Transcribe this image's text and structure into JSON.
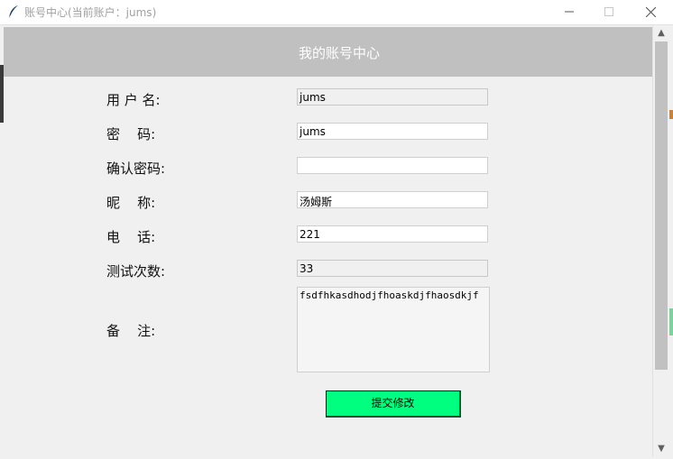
{
  "window": {
    "title": "账号中心(当前账户：jums)",
    "controls": {
      "minimize": "minimize",
      "maximize": "maximize",
      "close": "close"
    }
  },
  "header": {
    "title": "我的账号中心"
  },
  "form": {
    "username": {
      "label": "用 户 名:",
      "value": "jums",
      "readonly": true
    },
    "password": {
      "label": "密    码:",
      "value": "jums"
    },
    "confirm_password": {
      "label": "确认密码:",
      "value": ""
    },
    "nickname": {
      "label": "昵    称:",
      "value": "汤姆斯"
    },
    "phone": {
      "label": "电    话:",
      "value": "221"
    },
    "test_count": {
      "label": "测试次数:",
      "value": "33",
      "readonly": true
    },
    "notes": {
      "label": "备    注:",
      "value": "fsdfhkasdhodjfhoaskdjfhaosdkjf"
    }
  },
  "submit": {
    "label": "提交修改"
  },
  "colors": {
    "header_band": "#c0c0c0",
    "submit_button": "#00ff7f",
    "background": "#f0f0f0"
  },
  "icons": {
    "app": "feather-icon",
    "scroll_up": "chevron-up-icon",
    "scroll_down": "chevron-down-icon"
  }
}
